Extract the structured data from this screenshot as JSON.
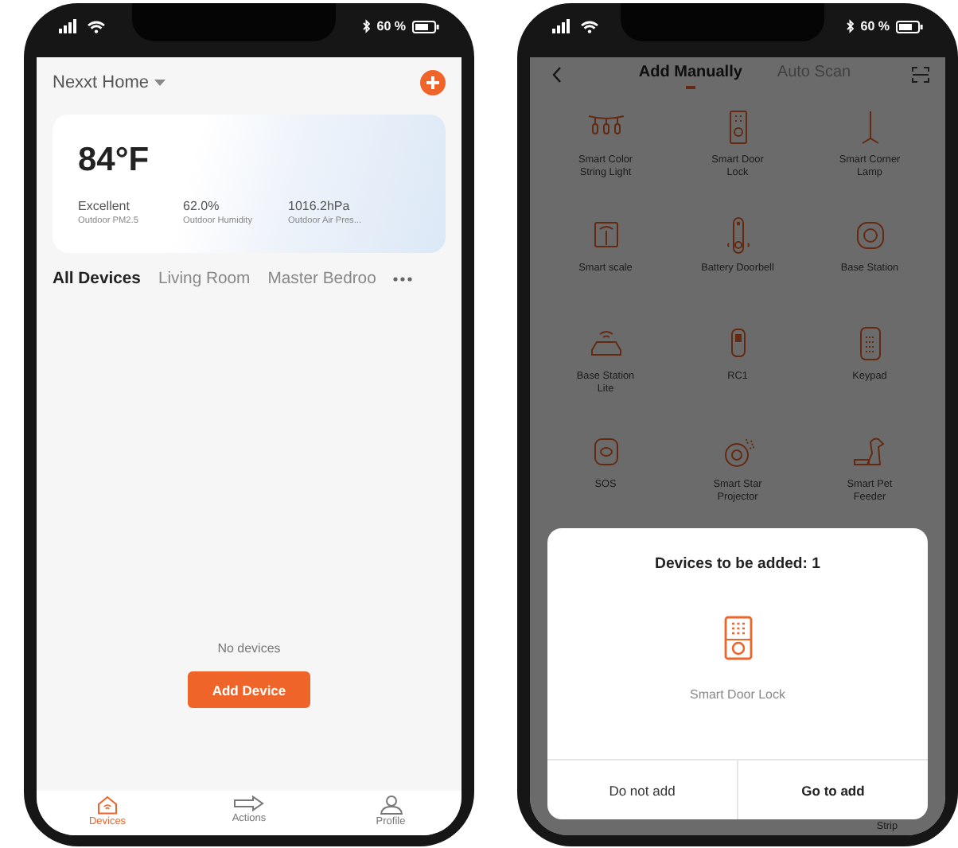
{
  "home_screen": {
    "status_bar": {
      "battery": "60 %"
    },
    "home_name": "Nexxt Home",
    "weather": {
      "temperature": "84°F",
      "stats": [
        {
          "value": "Excellent",
          "label": "Outdoor PM2.5"
        },
        {
          "value": "62.0%",
          "label": "Outdoor Humidity"
        },
        {
          "value": "1016.2hPa",
          "label": "Outdoor Air Pres..."
        }
      ]
    },
    "room_tabs": [
      {
        "label": "All Devices",
        "selected": true
      },
      {
        "label": "Living Room",
        "selected": false
      },
      {
        "label": "Master Bedroo",
        "selected": false
      }
    ],
    "empty_message": "No devices",
    "add_button": "Add Device",
    "nav": [
      {
        "label": "Devices",
        "selected": true
      },
      {
        "label": "Actions",
        "selected": false
      },
      {
        "label": "Profile",
        "selected": false
      }
    ]
  },
  "add_screen": {
    "status_bar": {
      "battery": "60 %"
    },
    "tabs": [
      {
        "label": "Add Manually",
        "selected": true
      },
      {
        "label": "Auto Scan",
        "selected": false
      }
    ],
    "devices": [
      {
        "name": "Smart Color String Light"
      },
      {
        "name": "Smart Door Lock"
      },
      {
        "name": "Smart Corner Lamp"
      },
      {
        "name": "Smart scale"
      },
      {
        "name": "Battery Doorbell"
      },
      {
        "name": "Base Station"
      },
      {
        "name": "Base Station Lite"
      },
      {
        "name": "RC1"
      },
      {
        "name": "Keypad"
      },
      {
        "name": "SOS"
      },
      {
        "name": "Smart Star Projector"
      },
      {
        "name": "Smart Pet Feeder"
      }
    ],
    "cut_off_label": "Strip",
    "dialog": {
      "title": "Devices to be added: 1",
      "device_name": "Smart Door Lock",
      "buttons": [
        {
          "label": "Do not add",
          "kind": "secondary"
        },
        {
          "label": "Go to add",
          "kind": "primary"
        }
      ]
    }
  }
}
